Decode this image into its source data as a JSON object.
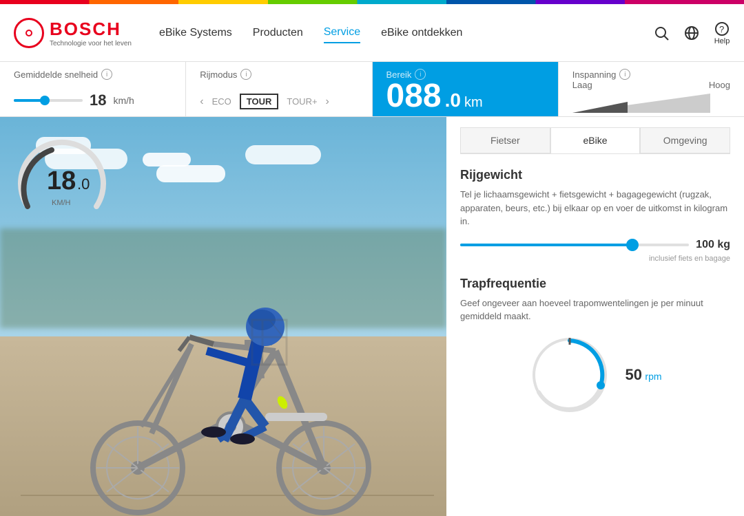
{
  "colorbar": {
    "label": "color-bar"
  },
  "header": {
    "logo_name": "BOSCH",
    "logo_tagline": "Technologie voor het leven",
    "nav_items": [
      {
        "label": "eBike Systems",
        "active": false
      },
      {
        "label": "Producten",
        "active": false
      },
      {
        "label": "Service",
        "active": true
      },
      {
        "label": "eBike ontdekken",
        "active": false
      }
    ],
    "help_label": "Help"
  },
  "controls": {
    "speed_section": {
      "label": "Gemiddelde snelheid",
      "value": "18",
      "unit": "km/h"
    },
    "mode_section": {
      "label": "Rijmodus",
      "modes": [
        "ECO",
        "TOUR",
        "TOUR+"
      ],
      "active_mode": "TOUR"
    },
    "bereik_section": {
      "label": "Bereik",
      "value": "088",
      "decimal": ".0",
      "unit": "km"
    },
    "inspanning_section": {
      "label": "Inspanning",
      "low_label": "Laag",
      "high_label": "Hoog"
    }
  },
  "speedometer": {
    "value": "18",
    "decimal": ".0",
    "unit": "KM/H"
  },
  "right_panel": {
    "tabs": [
      {
        "label": "Fietser",
        "active": false
      },
      {
        "label": "eBike",
        "active": true
      },
      {
        "label": "Omgeving",
        "active": false
      }
    ],
    "rijgewicht": {
      "title": "Rijgewicht",
      "description": "Tel je lichaamsgewicht + fietsgewicht + bagagegewicht (rugzak, apparaten, beurs, etc.) bij elkaar op en voer de uitkomst in kilogram in.",
      "value": "100",
      "unit": "kg",
      "sublabel": "inclusief fiets en bagage",
      "slider_percent": 75
    },
    "trapfrequentie": {
      "title": "Trapfrequentie",
      "description": "Geef ongeveer aan hoeveel trapomwentelingen je per minuut gemiddeld maakt.",
      "value": "50",
      "unit": "rpm"
    }
  }
}
